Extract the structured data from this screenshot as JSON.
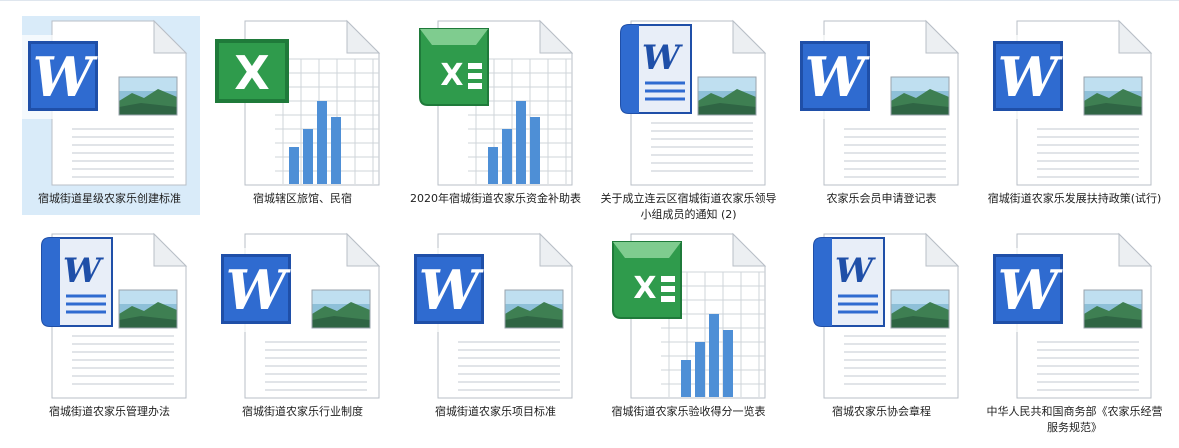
{
  "files": [
    {
      "name": "宿城街道星级农家乐创建标准",
      "type": "word-photo",
      "selected": true
    },
    {
      "name": "宿城辖区旅馆、民宿",
      "type": "excel-2007",
      "selected": false
    },
    {
      "name": "2020年宿城街道农家乐资金补助表",
      "type": "excel-2010",
      "selected": false
    },
    {
      "name": "关于成立连云区宿城街道农家乐领导小组成员的通知 (2)",
      "type": "word-doc",
      "selected": false
    },
    {
      "name": "农家乐会员申请登记表",
      "type": "word-photo",
      "selected": false
    },
    {
      "name": "宿城街道农家乐发展扶持政策(试行)",
      "type": "word-photo",
      "selected": false
    },
    {
      "name": "宿城街道农家乐管理办法",
      "type": "word-doc",
      "selected": false
    },
    {
      "name": "宿城街道农家乐行业制度",
      "type": "word-photo",
      "selected": false
    },
    {
      "name": "宿城街道农家乐项目标准",
      "type": "word-photo",
      "selected": false
    },
    {
      "name": "宿城街道农家乐验收得分一览表",
      "type": "excel-2010",
      "selected": false
    },
    {
      "name": "宿城农家乐协会章程",
      "type": "word-doc",
      "selected": false
    },
    {
      "name": "中华人民共和国商务部《农家乐经营服务规范》",
      "type": "word-photo",
      "selected": false
    }
  ]
}
